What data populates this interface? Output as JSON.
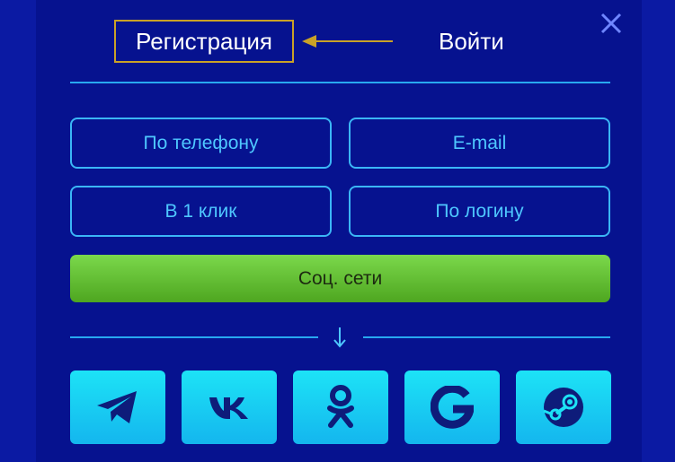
{
  "tabs": {
    "register_label": "Регистрация",
    "login_label": "Войти"
  },
  "methods": [
    {
      "label": "По телефону"
    },
    {
      "label": "E-mail"
    },
    {
      "label": "В 1 клик"
    },
    {
      "label": "По логину"
    }
  ],
  "social": {
    "button_label": "Соц. сети",
    "icons": [
      "telegram-icon",
      "vk-icon",
      "odnoklassniki-icon",
      "google-icon",
      "steam-icon"
    ]
  },
  "colors": {
    "background": "#0b1aa3",
    "modal": "#06128f",
    "accent_blue": "#3bb6f6",
    "green": "#5fbf30",
    "highlight_border": "#c9a227",
    "icon_tile": "#1de3f6"
  }
}
